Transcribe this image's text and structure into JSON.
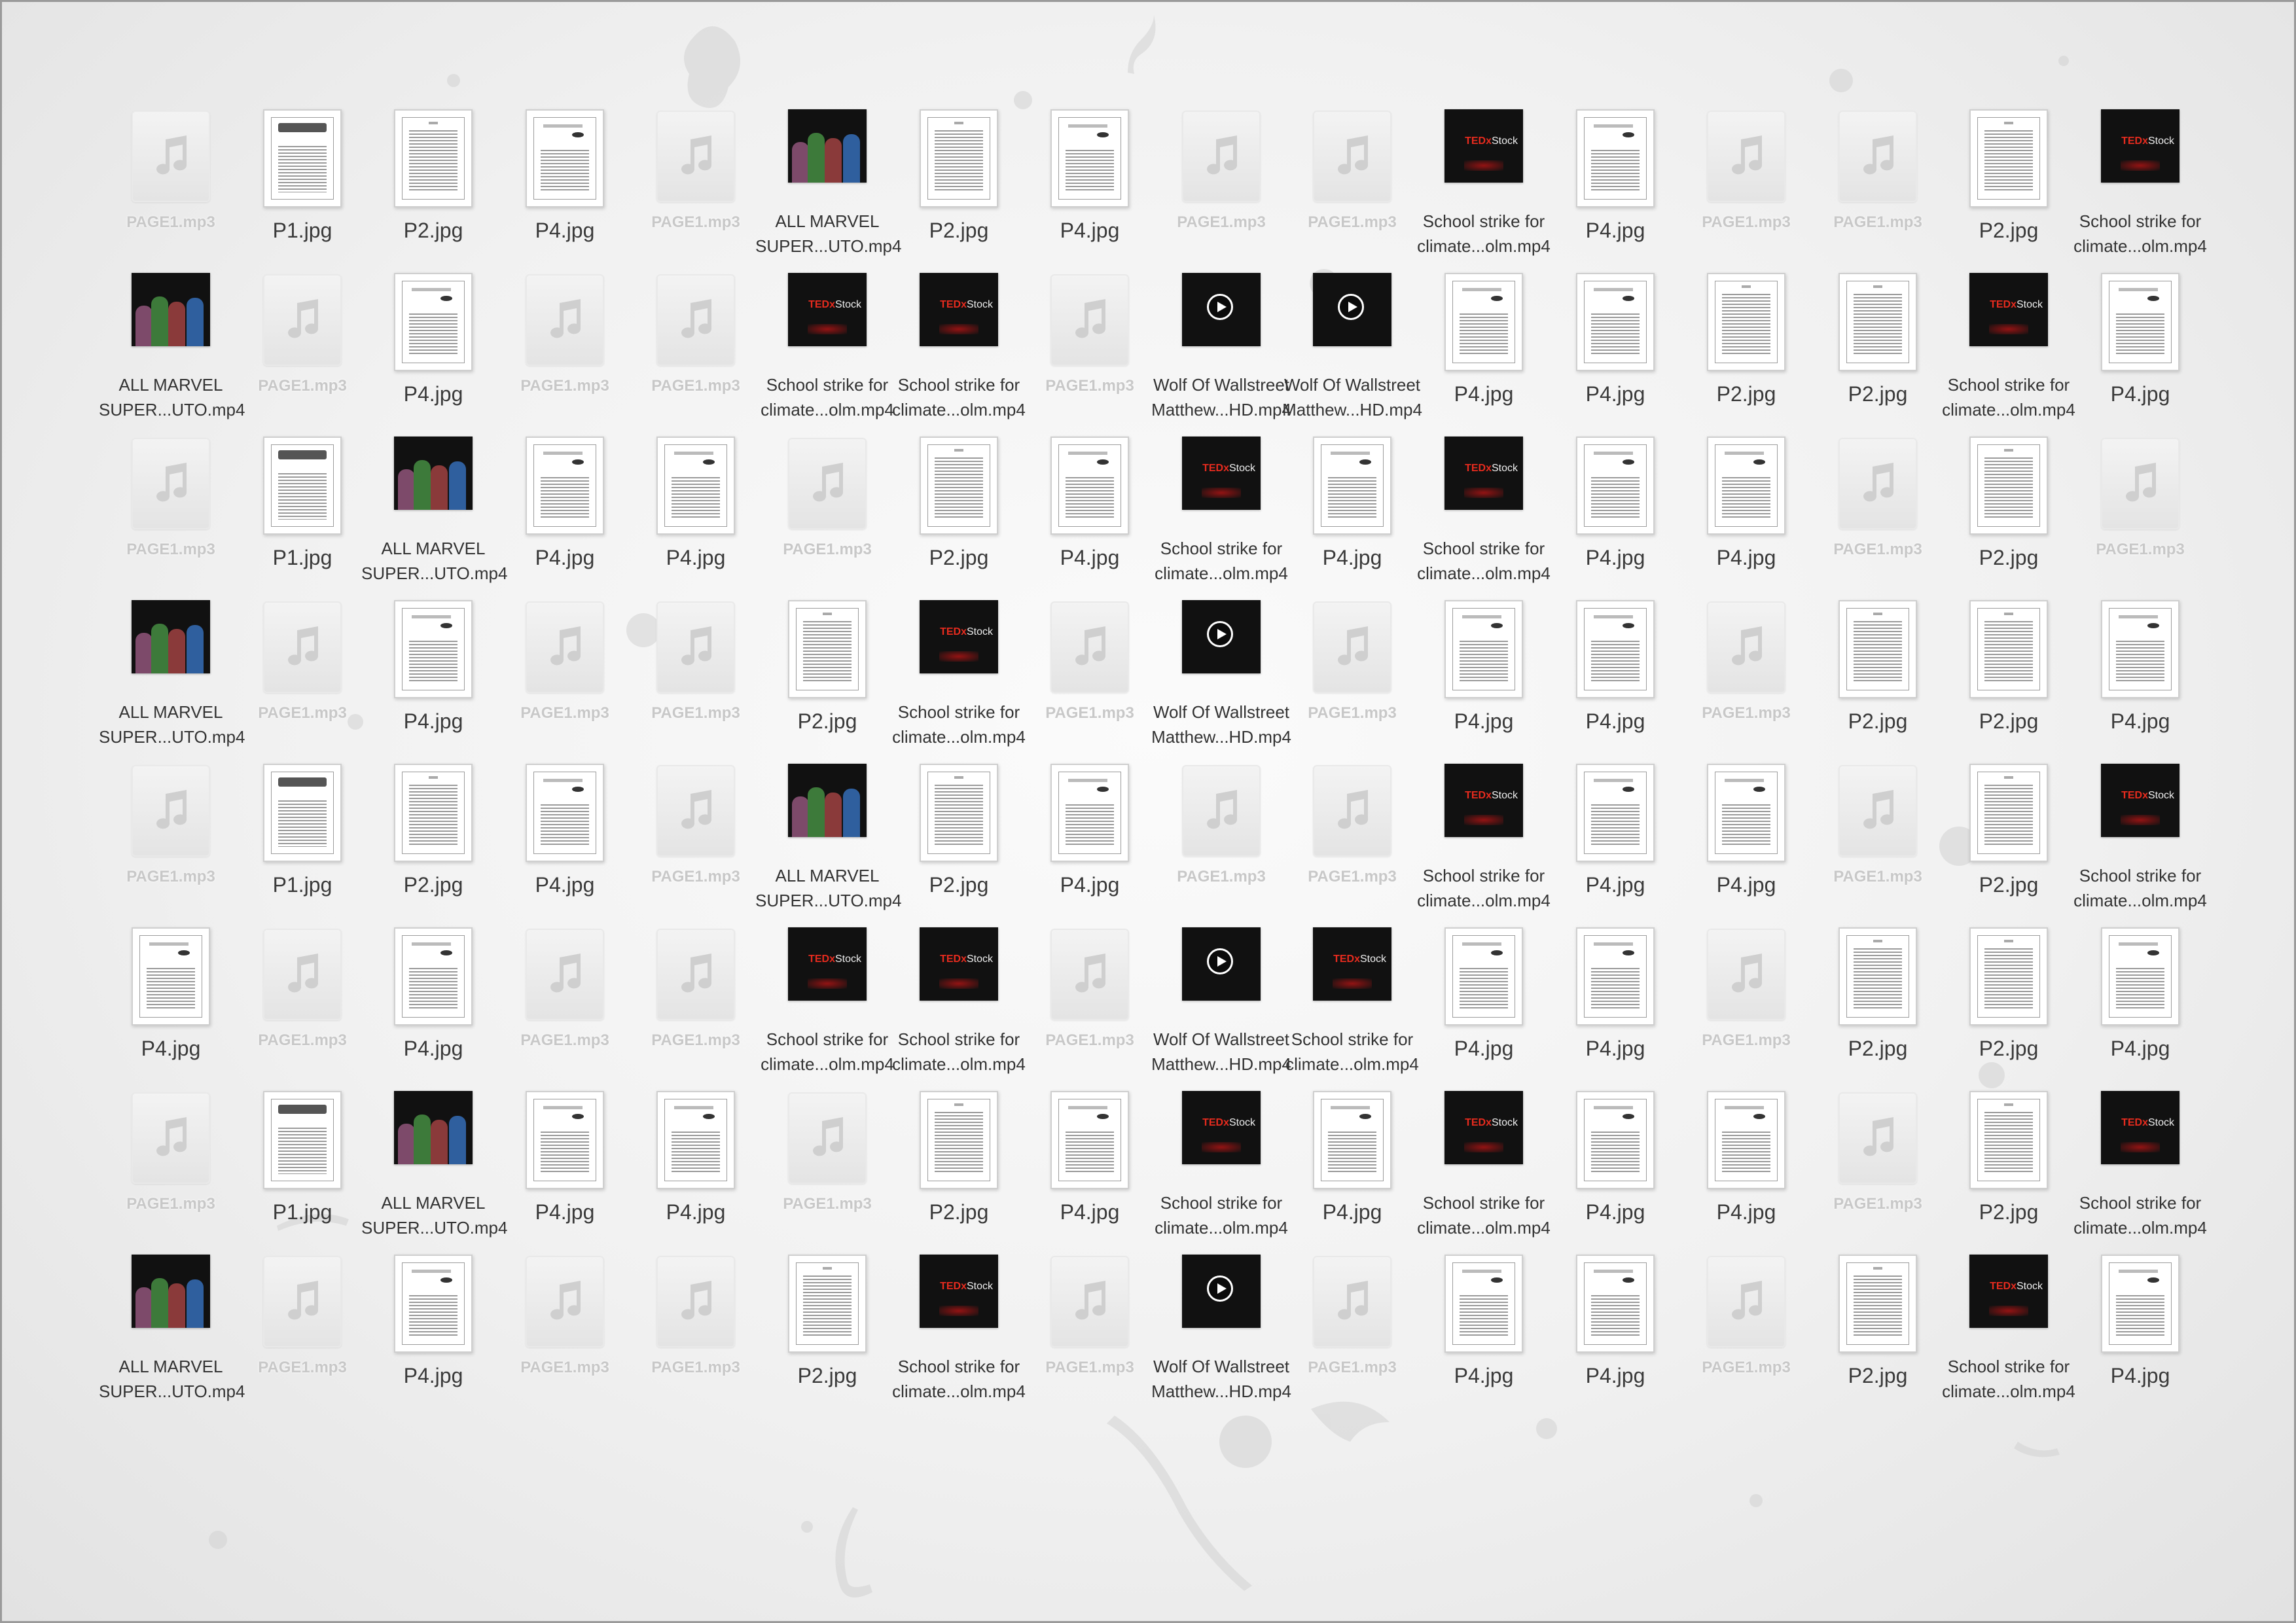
{
  "files": {
    "audio": "PAGE1.mp3",
    "p1": "P1.jpg",
    "p2": "P2.jpg",
    "p4": "P4.jpg",
    "marvel": [
      "ALL MARVEL",
      "SUPER...UTO.mp4"
    ],
    "school": [
      "School strike for",
      "climate...olm.mp4"
    ],
    "wolf": [
      "Wolf Of Wallstreet",
      "Matthew...HD.mp4"
    ]
  },
  "desktop_grid": [
    [
      "audio",
      "p1",
      "p2",
      "p4",
      "audio",
      "marvel",
      "p2",
      "p4",
      "audio",
      "audio",
      "school",
      "p4",
      "audio",
      "audio",
      "p2",
      "school"
    ],
    [
      "marvel",
      "audio",
      "p4",
      "audio",
      "audio",
      "school",
      "school",
      "audio",
      "wolf",
      "wolf",
      "p4",
      "p4",
      "p2",
      "p2",
      "school",
      "p4"
    ],
    [
      "audio",
      "p1",
      "marvel",
      "p4",
      "p4",
      "audio",
      "p2",
      "p4",
      "school",
      "p4",
      "school",
      "p4",
      "p4",
      "audio",
      "p2",
      "audio"
    ],
    [
      "marvel",
      "audio",
      "p4",
      "audio",
      "audio",
      "p2",
      "school",
      "audio",
      "wolf",
      "audio",
      "p4",
      "p4",
      "audio",
      "p2",
      "p2",
      "p4"
    ],
    [
      "audio",
      "p1",
      "p2",
      "p4",
      "audio",
      "marvel",
      "p2",
      "p4",
      "audio",
      "audio",
      "school",
      "p4",
      "p4",
      "audio",
      "p2",
      "school"
    ],
    [
      "p4",
      "audio",
      "p4",
      "audio",
      "audio",
      "school",
      "school",
      "audio",
      "wolf",
      "school",
      "p4",
      "p4",
      "audio",
      "p2",
      "p2",
      "p4"
    ],
    [
      "audio",
      "p1",
      "marvel",
      "p4",
      "p4",
      "audio",
      "p2",
      "p4",
      "school",
      "p4",
      "school",
      "p4",
      "p4",
      "audio",
      "p2",
      "school"
    ],
    [
      "marvel",
      "audio",
      "p4",
      "audio",
      "audio",
      "p2",
      "school",
      "audio",
      "wolf",
      "audio",
      "p4",
      "p4",
      "audio",
      "p2",
      "school",
      "p4"
    ]
  ],
  "colors": {
    "background": "#f1f1f1",
    "label_text": "#333333",
    "audio_label_text": "#c8c8c8",
    "tedx_red": "#e62b1e"
  },
  "icons": {
    "audio": "music-note-icon",
    "p1": "newspaper-document-icon",
    "p2": "text-document-icon",
    "p4": "text-document-icon",
    "marvel": "video-thumbnail-icon",
    "school": "video-thumbnail-icon",
    "wolf": "video-thumbnail-icon"
  }
}
